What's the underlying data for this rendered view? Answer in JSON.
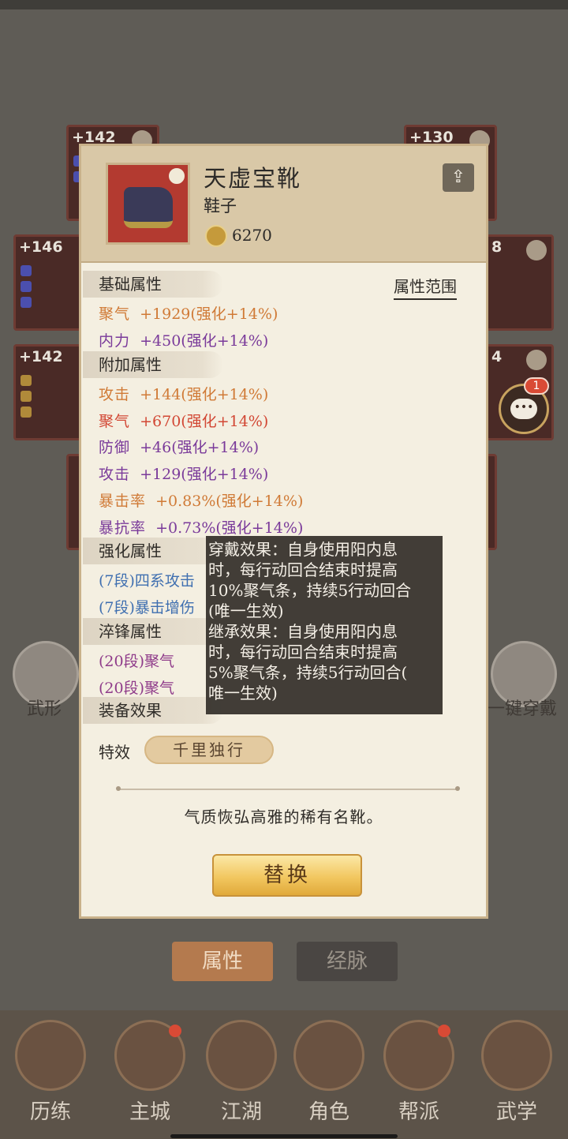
{
  "background": {
    "slots": [
      {
        "level": "+142"
      },
      {
        "level": "+130"
      },
      {
        "level": "+146"
      },
      {
        "level": "8"
      },
      {
        "level": "+142"
      },
      {
        "level": "4"
      }
    ],
    "side_left_label": "武形",
    "side_right_label": "一键穿戴",
    "tabs": [
      "属性",
      "经脉"
    ],
    "nav": [
      "历练",
      "主城",
      "江湖",
      "角色",
      "帮派",
      "武学"
    ]
  },
  "item": {
    "name": "天虚宝靴",
    "type": "鞋子",
    "power": "6270",
    "icon": "boots-icon",
    "share_icon": "share-icon"
  },
  "attr_range_label": "属性范围",
  "sections": {
    "base": "基础属性",
    "extra": "附加属性",
    "enhance": "强化属性",
    "temper": "淬锋属性",
    "effect": "装备效果"
  },
  "base_stats": [
    {
      "key": "聚气",
      "val": "+1929(强化+14%)"
    },
    {
      "key": "内力",
      "val": "+450(强化+14%)"
    }
  ],
  "extra_stats": [
    {
      "key": "攻击",
      "val": "+144(强化+14%)"
    },
    {
      "key": "聚气",
      "val": "+670(强化+14%)"
    },
    {
      "key": "防御",
      "val": "+46(强化+14%)"
    },
    {
      "key": "攻击",
      "val": "+129(强化+14%)"
    },
    {
      "key": "暴击率",
      "val": "+0.83%(强化+14%)"
    },
    {
      "key": "暴抗率",
      "val": "+0.73%(强化+14%)"
    }
  ],
  "enhance_stats": [
    {
      "text": "(7段)四系攻击"
    },
    {
      "text": "(7段)暴击增伤"
    }
  ],
  "temper_stats": [
    {
      "text": "(20段)聚气"
    },
    {
      "text": "(20段)聚气"
    }
  ],
  "special": {
    "label": "特效",
    "name": "千里独行"
  },
  "description": "气质恢弘高雅的稀有名靴。",
  "replace_label": "替换",
  "tooltip": {
    "lines": [
      "穿戴效果：自身使用阳内息",
      "时，每行动回合结束时提高",
      "10%聚气条，持续5行动回合",
      "(唯一生效)",
      "继承效果：自身使用阳内息",
      "时，每行动回合结束时提高",
      "5%聚气条，持续5行动回合(",
      "唯一生效)"
    ]
  },
  "chat_badge": "1",
  "colors": {
    "orange": "#d07a36",
    "purple": "#7a3a9a",
    "red": "#d24734",
    "blue": "#3f6fb0"
  }
}
